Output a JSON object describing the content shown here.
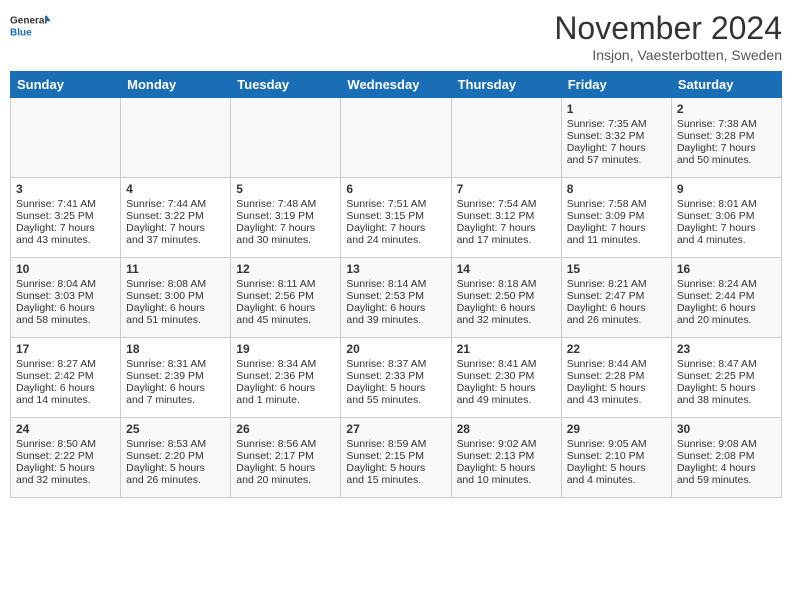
{
  "header": {
    "logo_general": "General",
    "logo_blue": "Blue",
    "month": "November 2024",
    "location": "Insjon, Vaesterbotten, Sweden"
  },
  "calendar": {
    "weekdays": [
      "Sunday",
      "Monday",
      "Tuesday",
      "Wednesday",
      "Thursday",
      "Friday",
      "Saturday"
    ],
    "weeks": [
      [
        {
          "day": "",
          "content": ""
        },
        {
          "day": "",
          "content": ""
        },
        {
          "day": "",
          "content": ""
        },
        {
          "day": "",
          "content": ""
        },
        {
          "day": "",
          "content": ""
        },
        {
          "day": "1",
          "content": "Sunrise: 7:35 AM\nSunset: 3:32 PM\nDaylight: 7 hours and 57 minutes."
        },
        {
          "day": "2",
          "content": "Sunrise: 7:38 AM\nSunset: 3:28 PM\nDaylight: 7 hours and 50 minutes."
        }
      ],
      [
        {
          "day": "3",
          "content": "Sunrise: 7:41 AM\nSunset: 3:25 PM\nDaylight: 7 hours and 43 minutes."
        },
        {
          "day": "4",
          "content": "Sunrise: 7:44 AM\nSunset: 3:22 PM\nDaylight: 7 hours and 37 minutes."
        },
        {
          "day": "5",
          "content": "Sunrise: 7:48 AM\nSunset: 3:19 PM\nDaylight: 7 hours and 30 minutes."
        },
        {
          "day": "6",
          "content": "Sunrise: 7:51 AM\nSunset: 3:15 PM\nDaylight: 7 hours and 24 minutes."
        },
        {
          "day": "7",
          "content": "Sunrise: 7:54 AM\nSunset: 3:12 PM\nDaylight: 7 hours and 17 minutes."
        },
        {
          "day": "8",
          "content": "Sunrise: 7:58 AM\nSunset: 3:09 PM\nDaylight: 7 hours and 11 minutes."
        },
        {
          "day": "9",
          "content": "Sunrise: 8:01 AM\nSunset: 3:06 PM\nDaylight: 7 hours and 4 minutes."
        }
      ],
      [
        {
          "day": "10",
          "content": "Sunrise: 8:04 AM\nSunset: 3:03 PM\nDaylight: 6 hours and 58 minutes."
        },
        {
          "day": "11",
          "content": "Sunrise: 8:08 AM\nSunset: 3:00 PM\nDaylight: 6 hours and 51 minutes."
        },
        {
          "day": "12",
          "content": "Sunrise: 8:11 AM\nSunset: 2:56 PM\nDaylight: 6 hours and 45 minutes."
        },
        {
          "day": "13",
          "content": "Sunrise: 8:14 AM\nSunset: 2:53 PM\nDaylight: 6 hours and 39 minutes."
        },
        {
          "day": "14",
          "content": "Sunrise: 8:18 AM\nSunset: 2:50 PM\nDaylight: 6 hours and 32 minutes."
        },
        {
          "day": "15",
          "content": "Sunrise: 8:21 AM\nSunset: 2:47 PM\nDaylight: 6 hours and 26 minutes."
        },
        {
          "day": "16",
          "content": "Sunrise: 8:24 AM\nSunset: 2:44 PM\nDaylight: 6 hours and 20 minutes."
        }
      ],
      [
        {
          "day": "17",
          "content": "Sunrise: 8:27 AM\nSunset: 2:42 PM\nDaylight: 6 hours and 14 minutes."
        },
        {
          "day": "18",
          "content": "Sunrise: 8:31 AM\nSunset: 2:39 PM\nDaylight: 6 hours and 7 minutes."
        },
        {
          "day": "19",
          "content": "Sunrise: 8:34 AM\nSunset: 2:36 PM\nDaylight: 6 hours and 1 minute."
        },
        {
          "day": "20",
          "content": "Sunrise: 8:37 AM\nSunset: 2:33 PM\nDaylight: 5 hours and 55 minutes."
        },
        {
          "day": "21",
          "content": "Sunrise: 8:41 AM\nSunset: 2:30 PM\nDaylight: 5 hours and 49 minutes."
        },
        {
          "day": "22",
          "content": "Sunrise: 8:44 AM\nSunset: 2:28 PM\nDaylight: 5 hours and 43 minutes."
        },
        {
          "day": "23",
          "content": "Sunrise: 8:47 AM\nSunset: 2:25 PM\nDaylight: 5 hours and 38 minutes."
        }
      ],
      [
        {
          "day": "24",
          "content": "Sunrise: 8:50 AM\nSunset: 2:22 PM\nDaylight: 5 hours and 32 minutes."
        },
        {
          "day": "25",
          "content": "Sunrise: 8:53 AM\nSunset: 2:20 PM\nDaylight: 5 hours and 26 minutes."
        },
        {
          "day": "26",
          "content": "Sunrise: 8:56 AM\nSunset: 2:17 PM\nDaylight: 5 hours and 20 minutes."
        },
        {
          "day": "27",
          "content": "Sunrise: 8:59 AM\nSunset: 2:15 PM\nDaylight: 5 hours and 15 minutes."
        },
        {
          "day": "28",
          "content": "Sunrise: 9:02 AM\nSunset: 2:13 PM\nDaylight: 5 hours and 10 minutes."
        },
        {
          "day": "29",
          "content": "Sunrise: 9:05 AM\nSunset: 2:10 PM\nDaylight: 5 hours and 4 minutes."
        },
        {
          "day": "30",
          "content": "Sunrise: 9:08 AM\nSunset: 2:08 PM\nDaylight: 4 hours and 59 minutes."
        }
      ]
    ]
  }
}
